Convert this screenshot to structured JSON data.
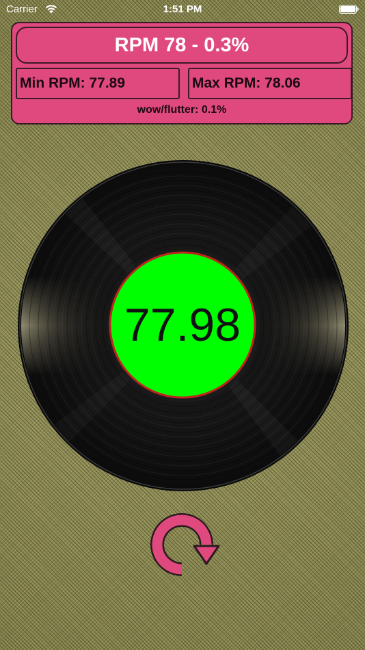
{
  "status_bar": {
    "carrier": "Carrier",
    "time": "1:51 PM"
  },
  "panel": {
    "rpm_title": "RPM 78 - 0.3%",
    "min_rpm": "Min RPM: 77.89",
    "max_rpm": "Max RPM: 78.06",
    "wow_flutter": "wow/flutter: 0.1%"
  },
  "record": {
    "speed_value": "77.98"
  },
  "colors": {
    "panel_pink": "#e0497e",
    "label_green": "#00ff00",
    "label_border_red": "#c0241e",
    "background_olive": "#8c8a53"
  },
  "icons": {
    "wifi": "wifi-icon",
    "battery": "battery-icon",
    "reset": "refresh-icon"
  }
}
